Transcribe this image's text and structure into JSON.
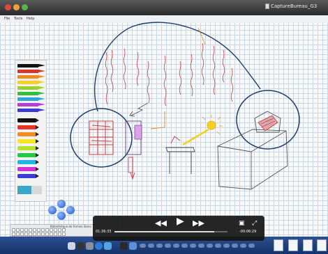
{
  "window": {
    "title": "CaptureBureau_G3"
  },
  "menu": {
    "items": [
      "File",
      "Tools",
      "Help"
    ]
  },
  "palette": {
    "pencil_colors": [
      "#111111",
      "#d9352b",
      "#f08a24",
      "#f6d21e",
      "#9ad12a",
      "#2fbf3f",
      "#2aa7d8",
      "#b23fd0",
      "#3a3ad8"
    ],
    "marker_colors": [
      "#111111",
      "#e5332a",
      "#f28c1f",
      "#f8e61c",
      "#b6e22a",
      "#21c84a",
      "#1fb6e6",
      "#d42fd0",
      "#3b3bd6"
    ]
  },
  "keyboard": {
    "label": "Bibliothèque de formes libres"
  },
  "player": {
    "elapsed": "01:36:33",
    "remaining": "-00:06:29",
    "progress": 0.88
  },
  "icons": {
    "rewind": "rewind-icon",
    "play": "play-icon",
    "forward": "fast-forward-icon",
    "caption": "caption-icon",
    "fullscreen": "fullscreen-icon"
  }
}
